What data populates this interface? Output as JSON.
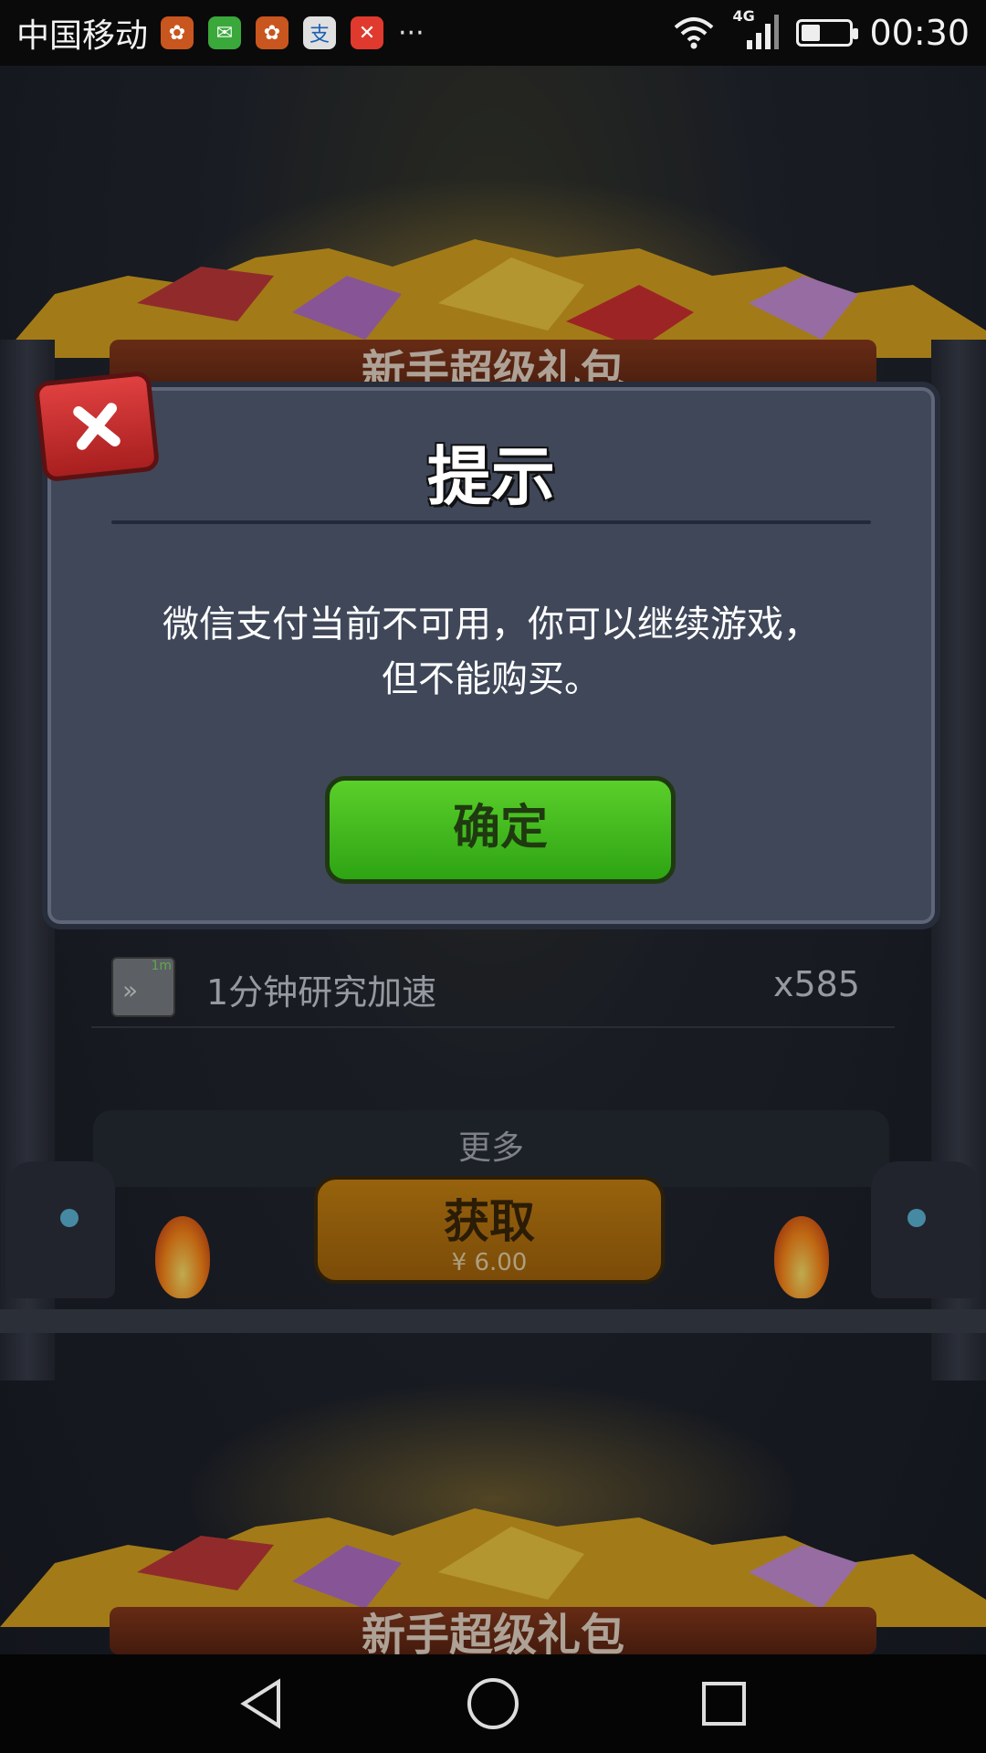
{
  "status_bar": {
    "carrier": "中国移动",
    "more": "···",
    "network": "4G",
    "time": "00:30",
    "battery_level": 0.4
  },
  "game": {
    "banner_text": "新手超级礼包",
    "list_item": {
      "label": "1分钟研究加速",
      "count": "x585",
      "icon_badge": "1m"
    },
    "more_label": "更多",
    "get_button": {
      "label": "获取",
      "price": "¥ 6.00"
    }
  },
  "dialog": {
    "title": "提示",
    "message_line1": "微信支付当前不可用，你可以继续游戏，",
    "message_line2": "但不能购买。",
    "confirm_label": "确定"
  },
  "colors": {
    "confirm_green": "#3cb81c",
    "close_red": "#c92b2b",
    "get_orange": "#b87410",
    "dialog_bg": "#3f4759"
  }
}
